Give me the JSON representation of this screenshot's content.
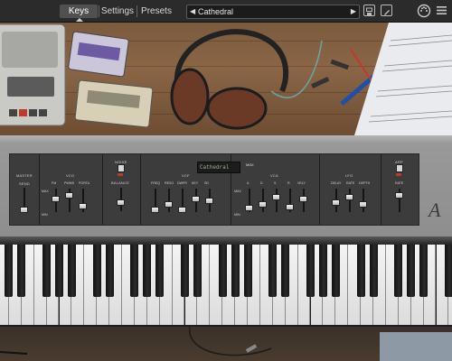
{
  "toolbar": {
    "tabs": [
      {
        "label": "Keys",
        "active": true
      },
      {
        "label": "Settings",
        "active": false
      },
      {
        "label": "Presets",
        "active": false
      }
    ],
    "preset": {
      "prev_glyph": "◀",
      "name": "Cathedral",
      "next_glyph": "▶"
    },
    "icons": [
      "save-icon",
      "edit-icon",
      "midi-icon",
      "menu-icon"
    ]
  },
  "synth_panel": {
    "display_text": "Cathedral",
    "display_badge": "MIDI",
    "noise": "NOISE",
    "balance": "BALANCE",
    "sections": [
      {
        "header": "MASTER",
        "sub": "SEND",
        "labels": []
      },
      {
        "header": "VCO",
        "labels": [
          "FM",
          "PWMS",
          "PORTA"
        ]
      },
      {
        "header": "VCF",
        "labels": [
          "FREQ",
          "RESO",
          "DWPR",
          "KEY",
          "SD"
        ]
      },
      {
        "header": "VCA",
        "labels": [
          "A",
          "D",
          "S",
          "R",
          "VELY"
        ]
      },
      {
        "header": "LFO",
        "labels": [
          "DELAY",
          "RATE",
          "DEPTH"
        ]
      },
      {
        "header": "ARP",
        "labels": [
          "RATE"
        ]
      }
    ],
    "max_label": "MAX",
    "min_label": "MIN",
    "logo": "A"
  }
}
